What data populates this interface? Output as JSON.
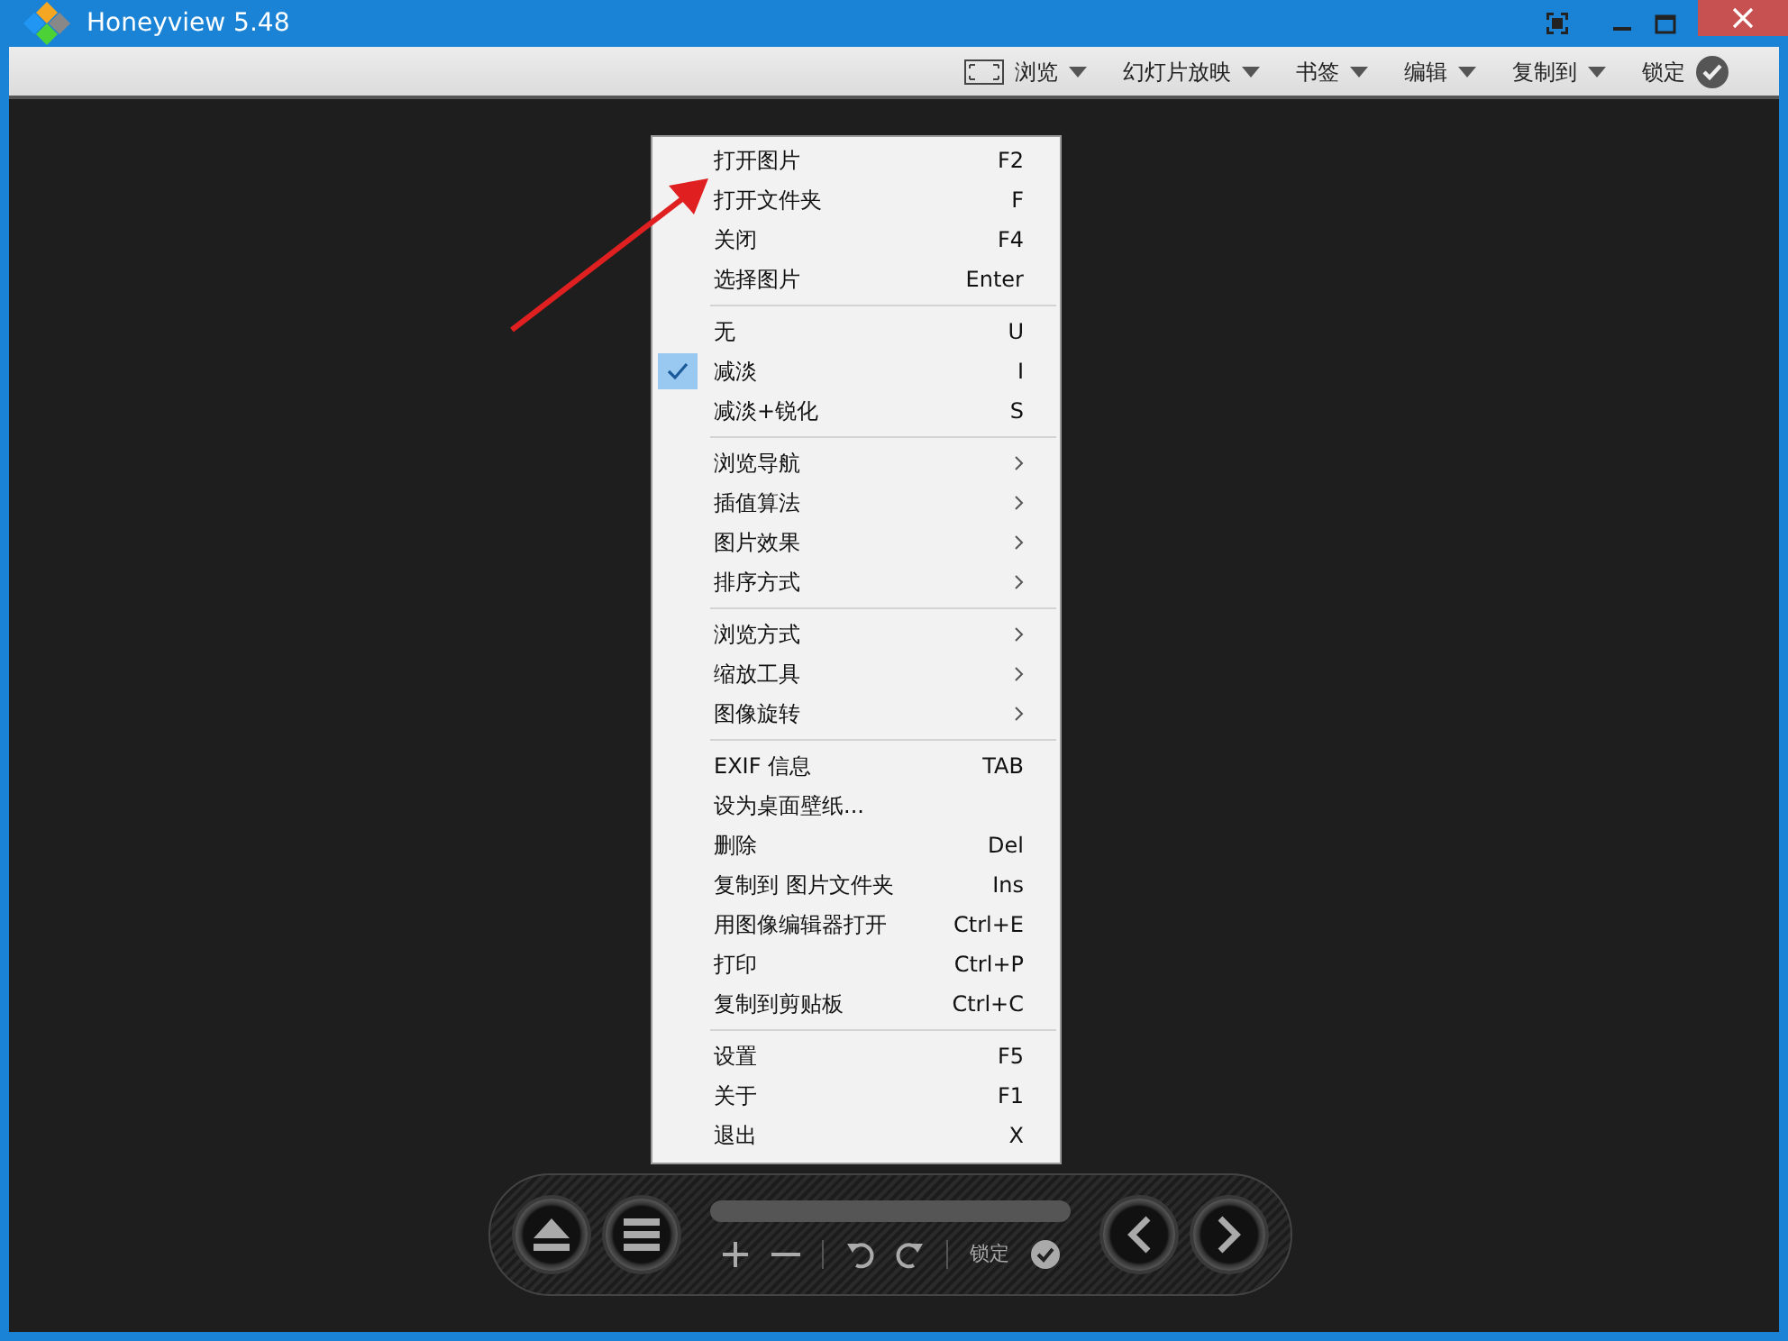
{
  "window": {
    "title": "Honeyview 5.48"
  },
  "toolbar": [
    {
      "kind": "view",
      "label": "浏览"
    },
    {
      "kind": "dropdown",
      "label": "幻灯片放映"
    },
    {
      "kind": "dropdown",
      "label": "书签"
    },
    {
      "kind": "dropdown",
      "label": "编辑"
    },
    {
      "kind": "dropdown",
      "label": "复制到"
    },
    {
      "kind": "lock",
      "label": "锁定"
    }
  ],
  "context_menu": [
    {
      "kind": "item",
      "label": "打开图片",
      "shortcut": "F2",
      "checked": false
    },
    {
      "kind": "item",
      "label": "打开文件夹",
      "shortcut": "F",
      "checked": false
    },
    {
      "kind": "item",
      "label": "关闭",
      "shortcut": "F4",
      "checked": false
    },
    {
      "kind": "item",
      "label": "选择图片",
      "shortcut": "Enter",
      "checked": false
    },
    {
      "kind": "separator"
    },
    {
      "kind": "item",
      "label": "无",
      "shortcut": "U",
      "checked": false
    },
    {
      "kind": "item",
      "label": "减淡",
      "shortcut": "I",
      "checked": true
    },
    {
      "kind": "item",
      "label": "减淡+锐化",
      "shortcut": "S",
      "checked": false
    },
    {
      "kind": "separator"
    },
    {
      "kind": "submenu",
      "label": "浏览导航"
    },
    {
      "kind": "submenu",
      "label": "插值算法"
    },
    {
      "kind": "submenu",
      "label": "图片效果"
    },
    {
      "kind": "submenu",
      "label": "排序方式"
    },
    {
      "kind": "separator"
    },
    {
      "kind": "submenu",
      "label": "浏览方式"
    },
    {
      "kind": "submenu",
      "label": "缩放工具"
    },
    {
      "kind": "submenu",
      "label": "图像旋转"
    },
    {
      "kind": "separator"
    },
    {
      "kind": "item",
      "label": "EXIF 信息",
      "shortcut": "TAB",
      "checked": false
    },
    {
      "kind": "item",
      "label": "设为桌面壁纸...",
      "checked": false
    },
    {
      "kind": "item",
      "label": "删除",
      "shortcut": "Del",
      "checked": false
    },
    {
      "kind": "item",
      "label": "复制到 图片文件夹",
      "shortcut": "Ins",
      "checked": false
    },
    {
      "kind": "item",
      "label": "用图像编辑器打开",
      "shortcut": "Ctrl+E",
      "checked": false
    },
    {
      "kind": "item",
      "label": "打印",
      "shortcut": "Ctrl+P",
      "checked": false
    },
    {
      "kind": "item",
      "label": "复制到剪贴板",
      "shortcut": "Ctrl+C",
      "checked": false
    },
    {
      "kind": "separator"
    },
    {
      "kind": "item",
      "label": "设置",
      "shortcut": "F5",
      "checked": false
    },
    {
      "kind": "item",
      "label": "关于",
      "shortcut": "F1",
      "checked": false
    },
    {
      "kind": "item",
      "label": "退出",
      "shortcut": "X",
      "checked": false
    }
  ],
  "bottom_bar": {
    "lock_label": "锁定"
  }
}
